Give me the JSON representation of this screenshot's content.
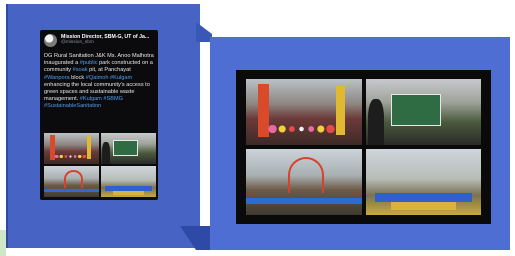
{
  "tweet": {
    "author_name": "Mission Director, SBM-G, UT of Ja...",
    "author_handle": "@mission_sbm",
    "text_parts": [
      {
        "t": "DG Rural Sanitation J&K Ms. Anoo Malhotra inaugurated a ",
        "tag": false
      },
      {
        "t": "#public",
        "tag": true
      },
      {
        "t": " park constructed on a community ",
        "tag": false
      },
      {
        "t": "#soak",
        "tag": true
      },
      {
        "t": " pit, at Panchayat ",
        "tag": false
      },
      {
        "t": "#Wanpora",
        "tag": true
      },
      {
        "t": " block ",
        "tag": false
      },
      {
        "t": "#Qaimoh",
        "tag": true
      },
      {
        "t": " ",
        "tag": false
      },
      {
        "t": "#Kulgam",
        "tag": true
      },
      {
        "t": " enhancing the local community's access to green spaces and sustainable waste management. ",
        "tag": false
      },
      {
        "t": "#Kulgam",
        "tag": true
      },
      {
        "t": " ",
        "tag": false
      },
      {
        "t": "#SBMG",
        "tag": true
      },
      {
        "t": " ",
        "tag": false
      },
      {
        "t": "#SustainableSanitation",
        "tag": true
      }
    ],
    "photos": [
      "inauguration-ribbon-photo",
      "photo-exhibit-photo",
      "park-gate-photo",
      "park-ground-photo"
    ]
  },
  "collage": {
    "photos": [
      "inauguration-ribbon-photo",
      "photo-exhibit-photo",
      "park-gate-photo",
      "park-ground-photo"
    ]
  },
  "colors": {
    "panel_blue": "#4763c4",
    "panel_blue_right": "#4f6ed3",
    "tweet_bg": "#0b0b0e",
    "hashtag": "#4f9ff0"
  }
}
